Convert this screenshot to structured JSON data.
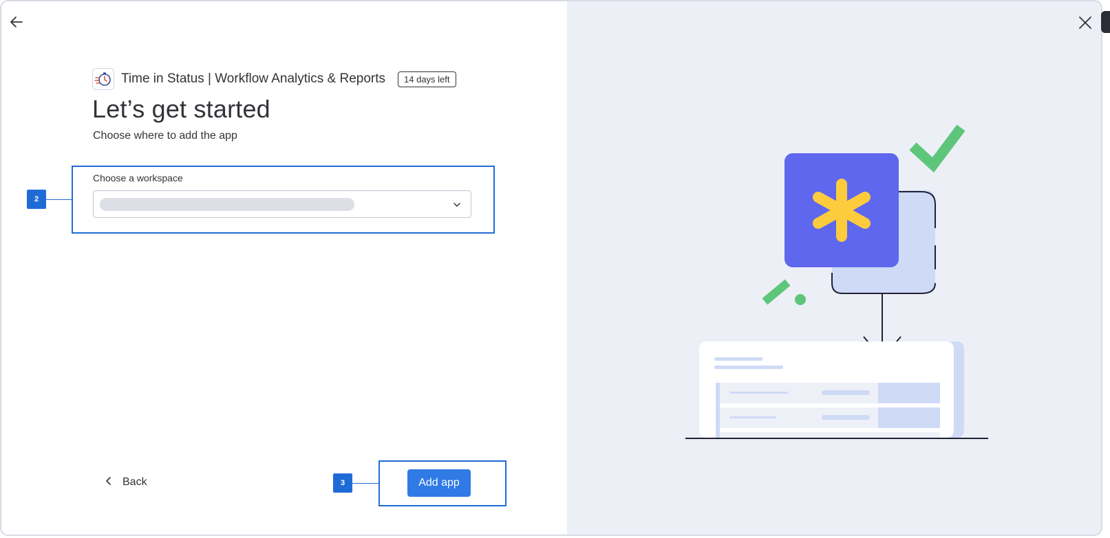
{
  "app": {
    "name": "Time in Status | Workflow Analytics & Reports",
    "trial_badge": "14 days left"
  },
  "page": {
    "title": "Let’s get started",
    "subtitle": "Choose where to add the app"
  },
  "workspace": {
    "label": "Choose a workspace",
    "selected_value": ""
  },
  "actions": {
    "back_label": "Back",
    "add_label": "Add app"
  },
  "annotations": [
    {
      "tag": "2"
    },
    {
      "tag": "3"
    }
  ],
  "icons": {
    "back": "arrow-left-icon",
    "close": "close-icon",
    "dropdown": "chevron-down-icon",
    "back_button": "chevron-left-icon",
    "app_logo": "stopwatch-icon"
  },
  "colors": {
    "primary": "#2f7ae5",
    "annotation": "#1f6bd6",
    "illustration_bg": "#edeff7",
    "card_purple": "#5f67ee",
    "asterisk_yellow": "#fdcc3c",
    "check_green": "#5ec67a"
  }
}
